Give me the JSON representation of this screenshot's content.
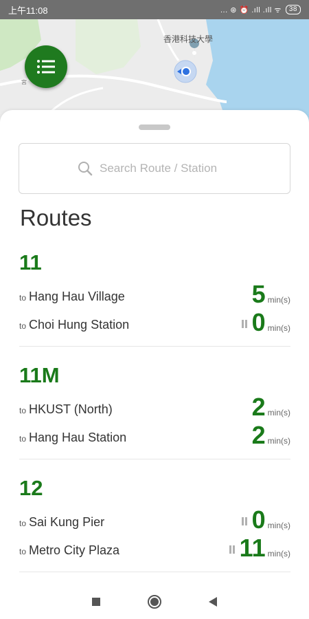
{
  "status_bar": {
    "time": "上午11:08",
    "indicators": "... ⊛ ⏰ .ıll .ıll ᯤ",
    "battery": "38"
  },
  "map": {
    "place_label": "香港科技大學",
    "road_label": "宮"
  },
  "search": {
    "placeholder": "Search Route / Station"
  },
  "section_title": "Routes",
  "routes": [
    {
      "number": "11",
      "destinations": [
        {
          "to": "to",
          "name": "Hang Hau Village",
          "eta": "5",
          "unit": "min(s)",
          "scheduled": false
        },
        {
          "to": "to",
          "name": "Choi Hung Station",
          "eta": "0",
          "unit": "min(s)",
          "scheduled": true
        }
      ]
    },
    {
      "number": "11M",
      "destinations": [
        {
          "to": "to",
          "name": "HKUST (North)",
          "eta": "2",
          "unit": "min(s)",
          "scheduled": false
        },
        {
          "to": "to",
          "name": "Hang Hau Station",
          "eta": "2",
          "unit": "min(s)",
          "scheduled": false
        }
      ]
    },
    {
      "number": "12",
      "destinations": [
        {
          "to": "to",
          "name": "Sai Kung Pier",
          "eta": "0",
          "unit": "min(s)",
          "scheduled": true
        },
        {
          "to": "to",
          "name": "Metro City Plaza",
          "eta": "11",
          "unit": "min(s)",
          "scheduled": true
        }
      ]
    }
  ],
  "colors": {
    "accent": "#1a7a1a",
    "map_water": "#a9d4ee",
    "map_park": "#cfe8c3"
  }
}
